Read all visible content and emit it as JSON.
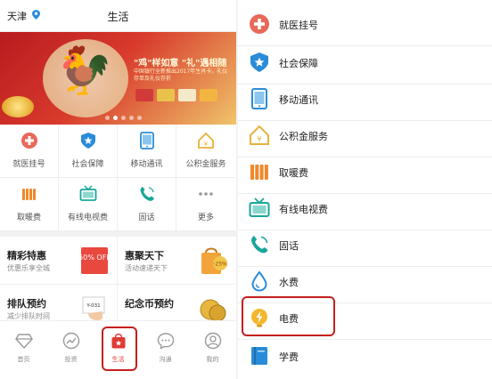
{
  "colors": {
    "accent": "#e03a36",
    "teal": "#18a69a",
    "blue": "#2a8cd8",
    "orange": "#f0882a",
    "yellow": "#e7b23c",
    "highlight": "#c51f1f"
  },
  "left": {
    "header": {
      "city": "天津",
      "title": "生活"
    },
    "banner": {
      "headline": "\"鸡\"样如意 \"礼\"遇相随",
      "subtitle": "中国银行全新推出2017年生肖卡，礼仪存单及礼仪存折",
      "slide_count": 5,
      "active_slide": 1
    },
    "services": [
      {
        "label": "就医挂号",
        "icon": "medical-plus-icon"
      },
      {
        "label": "社会保障",
        "icon": "shield-star-icon"
      },
      {
        "label": "移动通讯",
        "icon": "tablet-icon"
      },
      {
        "label": "公积金服务",
        "icon": "house-icon"
      },
      {
        "label": "取暖费",
        "icon": "radiator-icon"
      },
      {
        "label": "有线电视费",
        "icon": "tv-icon"
      },
      {
        "label": "固话",
        "icon": "phone-icon"
      },
      {
        "label": "更多",
        "icon": "more-icon"
      }
    ],
    "promos": [
      {
        "title": "精彩特惠",
        "subtitle": "优惠乐享全城",
        "badge": "50% OFF"
      },
      {
        "title": "惠聚天下",
        "subtitle": "活动速递天下",
        "badge": "-25%"
      },
      {
        "title": "排队预约",
        "subtitle": "减少排队时间",
        "badge": "Y-031"
      },
      {
        "title": "纪念币预约",
        "subtitle": "",
        "badge": ""
      }
    ],
    "tabbar": [
      {
        "label": "首页",
        "icon": "diamond-icon"
      },
      {
        "label": "投资",
        "icon": "trend-icon"
      },
      {
        "label": "生活",
        "icon": "bag-icon",
        "active": true
      },
      {
        "label": "沟通",
        "icon": "chat-icon"
      },
      {
        "label": "我的",
        "icon": "user-icon"
      }
    ]
  },
  "right": {
    "items": [
      {
        "label": "就医挂号",
        "icon": "medical-plus-icon"
      },
      {
        "label": "社会保障",
        "icon": "shield-star-icon"
      },
      {
        "label": "移动通讯",
        "icon": "tablet-icon"
      },
      {
        "label": "公积金服务",
        "icon": "house-icon"
      },
      {
        "label": "取暖费",
        "icon": "radiator-icon"
      },
      {
        "label": "有线电视费",
        "icon": "tv-icon"
      },
      {
        "label": "固话",
        "icon": "phone-icon"
      },
      {
        "label": "水费",
        "icon": "water-drop-icon"
      },
      {
        "label": "电费",
        "icon": "bulb-icon",
        "highlighted": true
      },
      {
        "label": "学费",
        "icon": "book-icon"
      }
    ]
  }
}
